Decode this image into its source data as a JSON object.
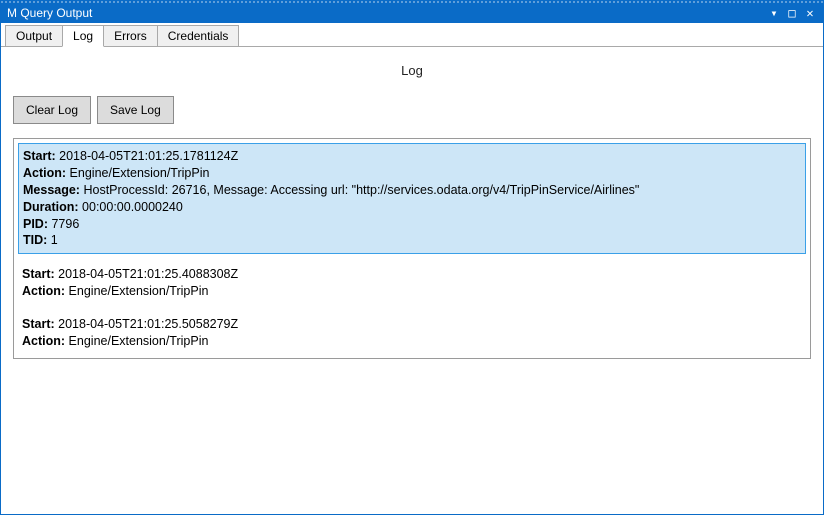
{
  "window": {
    "title": "M Query Output"
  },
  "tabs": [
    {
      "label": "Output",
      "active": false
    },
    {
      "label": "Log",
      "active": true
    },
    {
      "label": "Errors",
      "active": false
    },
    {
      "label": "Credentials",
      "active": false
    }
  ],
  "pane_title": "Log",
  "toolbar": {
    "clear_label": "Clear Log",
    "save_label": "Save Log"
  },
  "field_labels": {
    "start": "Start:",
    "action": "Action:",
    "message": "Message:",
    "duration": "Duration:",
    "pid": "PID:",
    "tid": "TID:"
  },
  "entries": [
    {
      "selected": true,
      "start": "2018-04-05T21:01:25.1781124Z",
      "action": "Engine/Extension/TripPin",
      "message": "HostProcessId: 26716, Message: Accessing url: \"http://services.odata.org/v4/TripPinService/Airlines\"",
      "duration": "00:00:00.0000240",
      "pid": "7796",
      "tid": "1"
    },
    {
      "selected": false,
      "start": "2018-04-05T21:01:25.4088308Z",
      "action": "Engine/Extension/TripPin"
    },
    {
      "selected": false,
      "start": "2018-04-05T21:01:25.5058279Z",
      "action": "Engine/Extension/TripPin"
    }
  ]
}
